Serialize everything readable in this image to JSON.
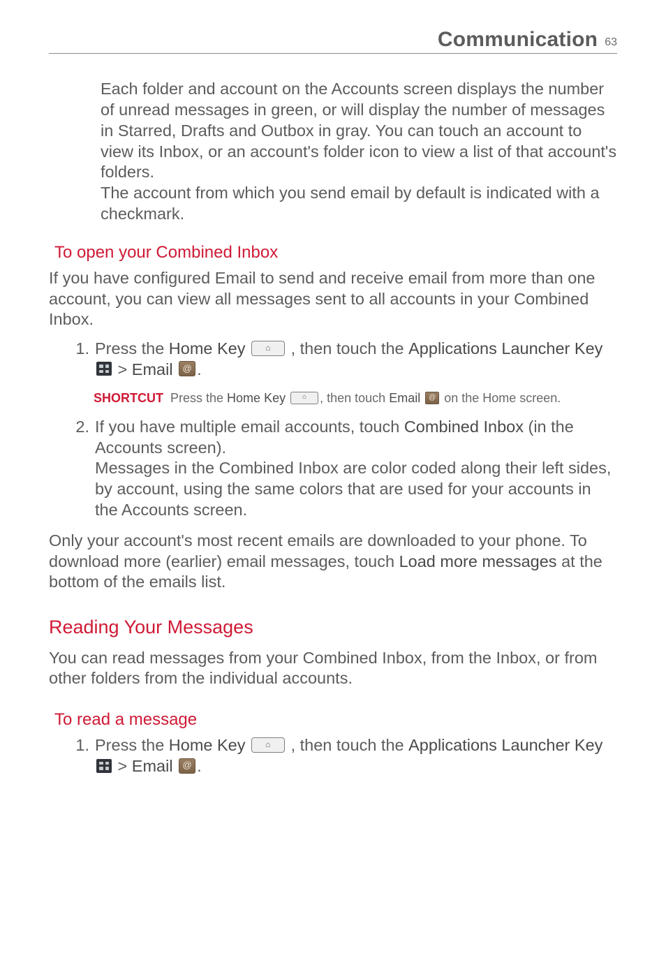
{
  "header": {
    "title": "Communication",
    "page_number": "63"
  },
  "intro_block": "Each folder and account on the Accounts screen displays the number of unread messages in green, or will display the number of messages in Starred, Drafts and Outbox in gray. You can touch an account to view its Inbox, or an account's folder icon to view a list of that account's folders.\nThe account from which you send email by default is indicated with a checkmark.",
  "section1": {
    "heading": "To open your Combined Inbox",
    "intro": "If you have configured Email to send and receive email from more than one account, you can view all messages sent to all accounts in your Combined Inbox.",
    "step1": {
      "num": "1.",
      "pre": "Press the ",
      "home_key": "Home Key",
      "mid1": " , then touch the ",
      "apps": "Applications Launcher Key",
      "gt": " > ",
      "email": "Email",
      "end": "."
    },
    "shortcut": {
      "label": "SHORTCUT",
      "pre": "Press the ",
      "home_key": "Home Key",
      "mid": ", then touch ",
      "email": "Email",
      "post": " on the Home screen."
    },
    "step2": {
      "num": "2.",
      "line1a": "If you have multiple email accounts, touch ",
      "line1b": "Combined Inbox",
      "line1c": " (in the Accounts screen).",
      "line2": "Messages in the Combined Inbox are color coded along their left sides, by account, using the same colors that are used for your accounts in the Accounts screen."
    },
    "outro_a": "Only your account's most recent emails are downloaded to your phone. To download more (earlier) email messages, touch ",
    "outro_b": "Load more messages",
    "outro_c": " at the bottom of the emails list."
  },
  "section2": {
    "heading": "Reading Your Messages",
    "intro": "You can read messages from your Combined Inbox, from the Inbox, or from other folders from the individual accounts.",
    "sub_heading": "To read a message",
    "step1": {
      "num": "1.",
      "pre": "Press the ",
      "home_key": "Home Key",
      "mid1": " , then touch the ",
      "apps": "Applications Launcher Key",
      "gt": " > ",
      "email": "Email",
      "end": "."
    }
  }
}
